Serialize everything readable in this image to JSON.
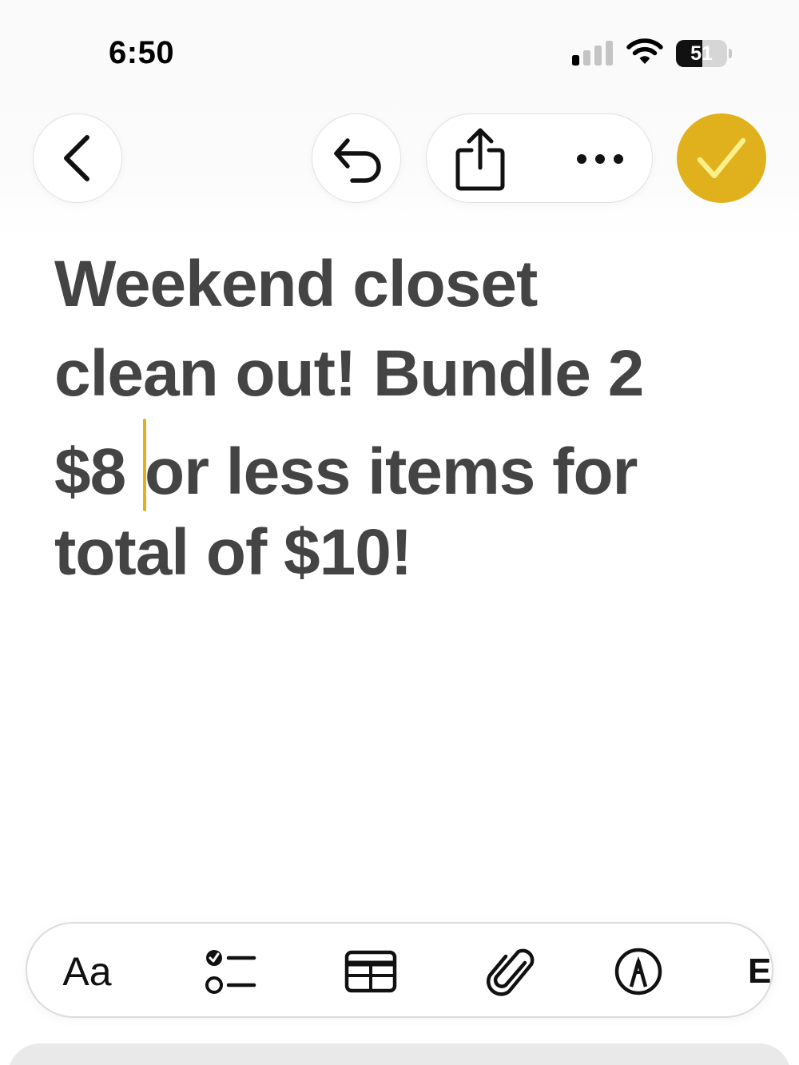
{
  "status_bar": {
    "time": "6:50",
    "battery_percent": "51",
    "battery_level": 0.51,
    "signal_bars_active": 1,
    "signal_bars_total": 4
  },
  "toolbar": {
    "back_icon": "chevron-left-icon",
    "undo_icon": "undo-icon",
    "share_icon": "share-icon",
    "more_icon": "ellipsis-icon",
    "done_icon": "checkmark-icon",
    "accent_color": "#e0b11c"
  },
  "note": {
    "lines": [
      "Weekend closet",
      "clean out! Bundle 2",
      "$8 ",
      "or less items for",
      "total of $10!"
    ],
    "text_color": "#444444"
  },
  "format_bar": {
    "text_style_label": "Aa",
    "checklist_icon": "checklist-icon",
    "table_icon": "table-icon",
    "attachment_icon": "paperclip-icon",
    "markup_icon": "pen-markup-icon",
    "partial_label": "E"
  }
}
